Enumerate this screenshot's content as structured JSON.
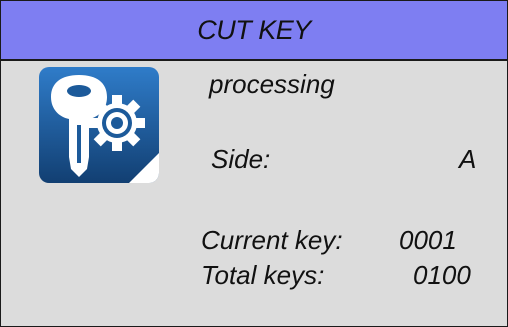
{
  "title": "CUT KEY",
  "icon": "key-cutting-icon",
  "status": "processing",
  "side": {
    "label": "Side:",
    "value": "A"
  },
  "current_key": {
    "label": "Current key:",
    "value": "0001"
  },
  "total_keys": {
    "label": "Total keys:",
    "value": "0100"
  },
  "colors": {
    "title_bar": "#7e7ef2",
    "background": "#dcdcdc",
    "icon_blue": "#1a5a9e"
  }
}
